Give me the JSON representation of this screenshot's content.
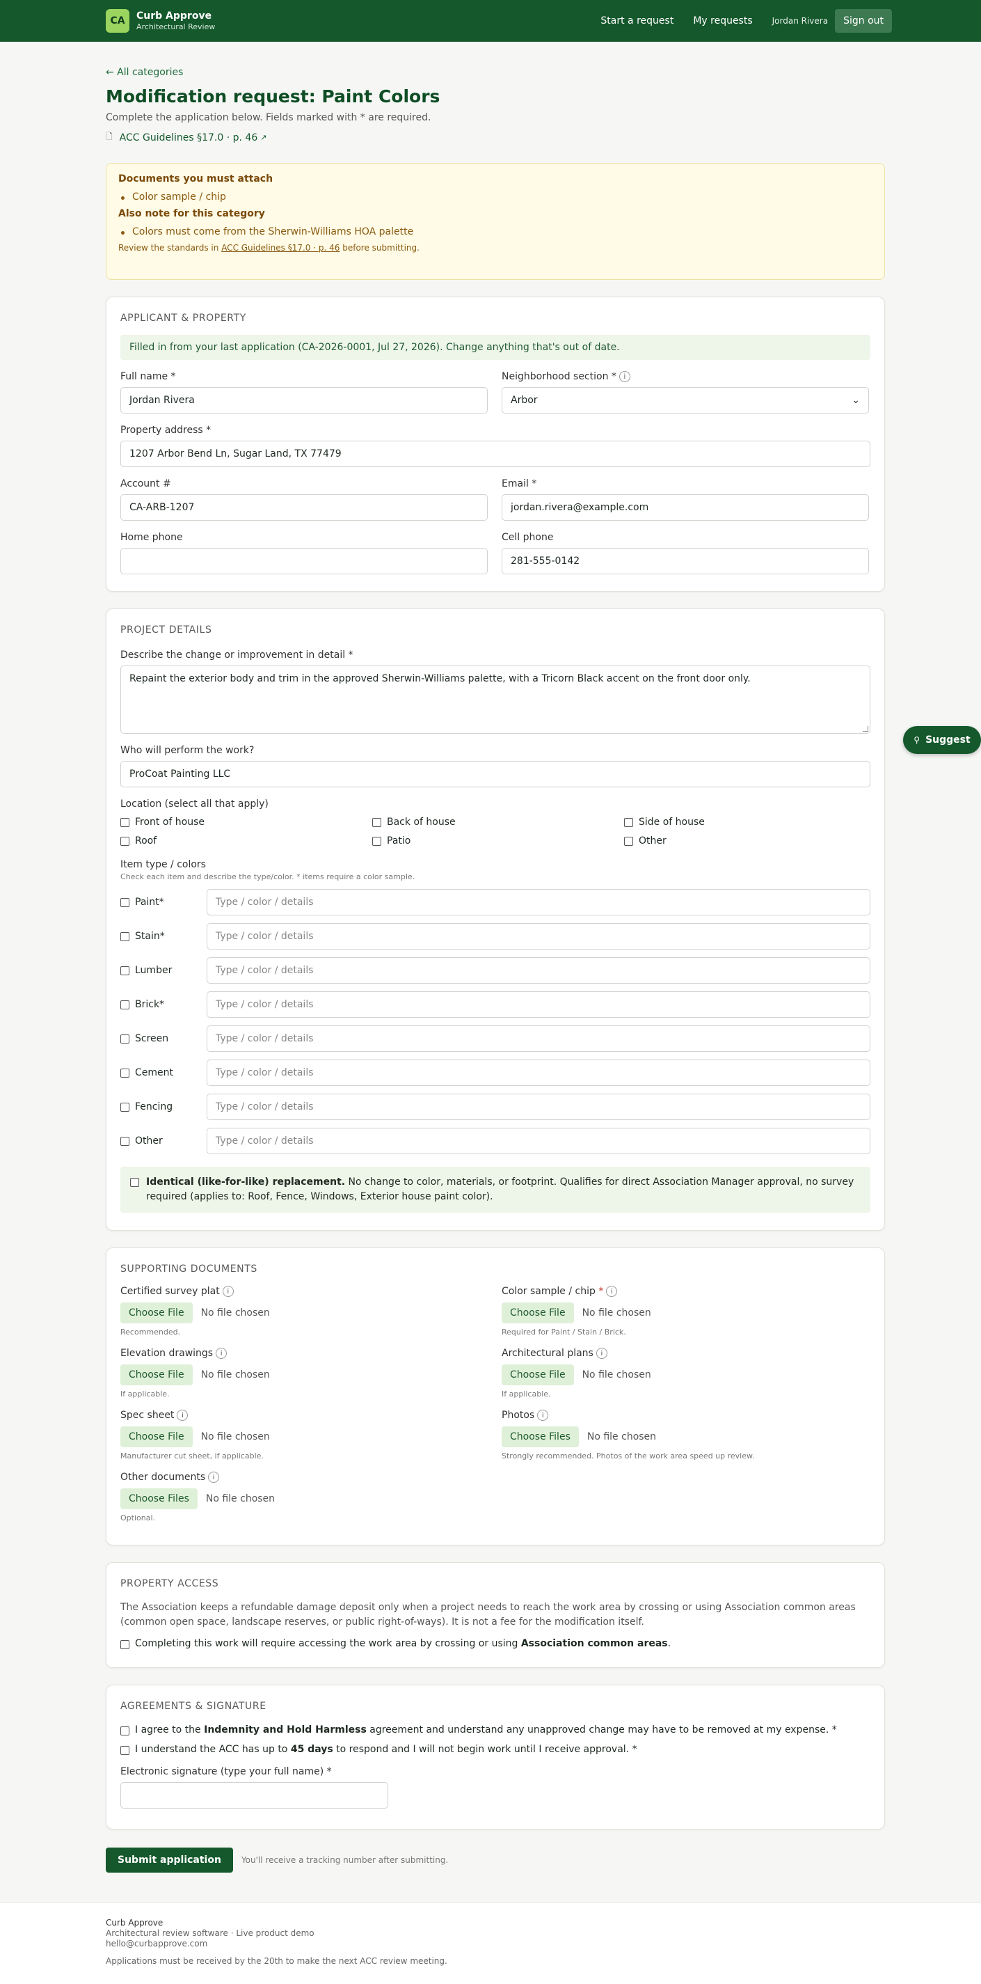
{
  "app": {
    "logo": "CA",
    "name": "Curb Approve",
    "tagline": "Architectural Review"
  },
  "nav": {
    "start": "Start a request",
    "my_requests": "My requests",
    "user": "Jordan Rivera",
    "signout": "Sign out"
  },
  "header": {
    "back": "← All categories",
    "title": "Modification request: Paint Colors",
    "subtitle": "Complete the application below. Fields marked with * are required.",
    "guideline": "ACC Guidelines §17.0 · p. 46"
  },
  "notice": {
    "docs_title": "Documents you must attach",
    "docs": [
      "Color sample / chip"
    ],
    "note_title": "Also note for this category",
    "notes": [
      "Colors must come from the Sherwin-Williams HOA palette"
    ],
    "review_pre": "Review the standards in ",
    "review_link": "ACC Guidelines §17.0 · p. 46",
    "review_post": " before submitting."
  },
  "applicant": {
    "heading": "Applicant & Property",
    "prefill": "Filled in from your last application (CA-2026-0001, Jul 27, 2026). Change anything that's out of date.",
    "full_name_label": "Full name *",
    "full_name": "Jordan Rivera",
    "section_label": "Neighborhood section *",
    "section": "Arbor",
    "address_label": "Property address *",
    "address": "1207 Arbor Bend Ln, Sugar Land, TX 77479",
    "account_label": "Account #",
    "account": "CA-ARB-1207",
    "email_label": "Email *",
    "email": "jordan.rivera@example.com",
    "home_phone_label": "Home phone",
    "home_phone": "",
    "cell_phone_label": "Cell phone",
    "cell_phone": "281-555-0142"
  },
  "project": {
    "heading": "Project Details",
    "describe_label": "Describe the change or improvement in detail *",
    "describe": "Repaint the exterior body and trim in the approved Sherwin-Williams palette, with a Tricorn Black accent on the front door only.",
    "performer_label": "Who will perform the work?",
    "performer": "ProCoat Painting LLC",
    "location_label": "Location (select all that apply)",
    "locations": [
      "Front of house",
      "Back of house",
      "Side of house",
      "Roof",
      "Patio",
      "Other"
    ],
    "itemtype_label": "Item type / colors",
    "itemtype_hint": "Check each item and describe the type/color. * items require a color sample.",
    "item_placeholder": "Type / color / details",
    "items": [
      "Paint*",
      "Stain*",
      "Lumber",
      "Brick*",
      "Screen",
      "Cement",
      "Fencing",
      "Other"
    ],
    "identical_bold": "Identical (like-for-like) replacement.",
    "identical_text": " No change to color, materials, or footprint. Qualifies for direct Association Manager approval, no survey required (applies to: Roof, Fence, Windows, Exterior house paint color)."
  },
  "documents": {
    "heading": "Supporting Documents",
    "no_file": "No file chosen",
    "items": [
      {
        "label": "Certified survey plat",
        "required": "",
        "button": "Choose File",
        "note": "Recommended."
      },
      {
        "label": "Color sample / chip",
        "required": "*",
        "button": "Choose File",
        "note": "Required for Paint / Stain / Brick."
      },
      {
        "label": "Elevation drawings",
        "required": "",
        "button": "Choose File",
        "note": "If applicable."
      },
      {
        "label": "Architectural plans",
        "required": "",
        "button": "Choose File",
        "note": "If applicable."
      },
      {
        "label": "Spec sheet",
        "required": "",
        "button": "Choose File",
        "note": "Manufacturer cut sheet, if applicable."
      },
      {
        "label": "Photos",
        "required": "",
        "button": "Choose Files",
        "note": "Strongly recommended. Photos of the work area speed up review."
      },
      {
        "label": "Other documents",
        "required": "",
        "button": "Choose Files",
        "note": "Optional."
      }
    ]
  },
  "access": {
    "heading": "Property Access",
    "text": "The Association keeps a refundable damage deposit only when a project needs to reach the work area by crossing or using Association common areas (common open space, landscape reserves, or public right-of-ways). It is not a fee for the modification itself.",
    "check_pre": "Completing this work will require accessing the work area by crossing or using ",
    "check_bold": "Association common areas",
    "check_post": "."
  },
  "agreements": {
    "heading": "Agreements & Signature",
    "a1_pre": "I agree to the ",
    "a1_bold": "Indemnity and Hold Harmless",
    "a1_post": " agreement and understand any unapproved change may have to be removed at my expense. *",
    "a2_pre": "I understand the ACC has up to ",
    "a2_bold": "45 days",
    "a2_post": " to respond and I will not begin work until I receive approval. *",
    "signature_label": "Electronic signature (type your full name) *"
  },
  "submit": {
    "button": "Submit application",
    "note": "You'll receive a tracking number after submitting."
  },
  "footer": {
    "name": "Curb Approve",
    "line1": "Architectural review software · Live product demo",
    "email": "hello@curbapprove.com",
    "deadline": "Applications must be received by the 20th to make the next ACC review meeting."
  },
  "suggest": {
    "label": "Suggest"
  }
}
